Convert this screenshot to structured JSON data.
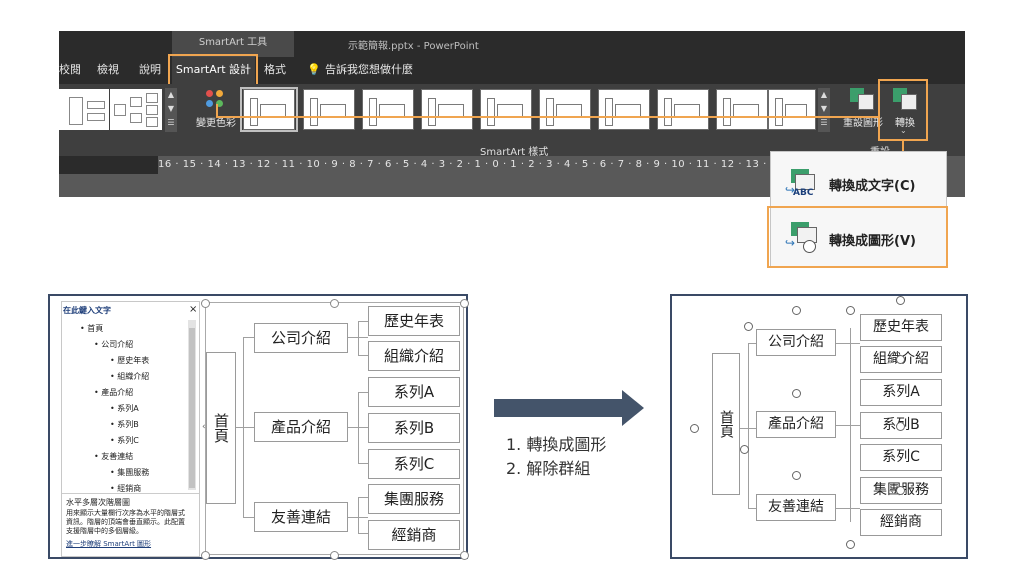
{
  "titlebar": {
    "context_group": "SmartArt 工具",
    "document": "示範簡報.pptx  -  PowerPoint"
  },
  "tabs": [
    "校閱",
    "檢視",
    "說明",
    "SmartArt 設計",
    "格式"
  ],
  "tell_me": "告訴我您想做什麼",
  "ribbon": {
    "change_colors": "變更色彩",
    "gallery_label": "SmartArt 樣式",
    "reset_group_label": "重設",
    "reset_button": "重設圖形",
    "convert_button": "轉換",
    "ruler": "16 · 15 · 14 · 13 · 12 · 11 · 10 · 9 · 8 · 7 · 6 · 5 · 4 · 3 · 2 · 1 · 0 · 1 · 2 · 3 · 4 · 5 · 6 · 7 · 8 · 9 · 10 · 11 · 12 · 13 · 14"
  },
  "convert_menu": {
    "to_text": "轉換成文字(C)",
    "to_shapes": "轉換成圖形(V)"
  },
  "text_pane": {
    "title": "在此鍵入文字",
    "close": "×",
    "items": [
      {
        "level": 1,
        "text": "首頁"
      },
      {
        "level": 2,
        "text": "公司介紹"
      },
      {
        "level": 3,
        "text": "歷史年表"
      },
      {
        "level": 3,
        "text": "組織介紹"
      },
      {
        "level": 2,
        "text": "產品介紹"
      },
      {
        "level": 3,
        "text": "系列A"
      },
      {
        "level": 3,
        "text": "系列B"
      },
      {
        "level": 3,
        "text": "系列C"
      },
      {
        "level": 2,
        "text": "友善連結"
      },
      {
        "level": 3,
        "text": "集團服務"
      },
      {
        "level": 3,
        "text": "經銷商"
      }
    ],
    "desc_title": "水平多層次階層圖",
    "desc_body_1": "用來顯示大量欄行次序為水平的階層式",
    "desc_body_2": "資訊。階層的頂端會垂直顯示。此配置",
    "desc_body_3": "支援階層中的多個層級。",
    "learn_more": "進一步瞭解 SmartArt 圖形"
  },
  "smartart": {
    "root": "首頁",
    "level2": [
      "公司介紹",
      "產品介紹",
      "友善連結"
    ],
    "level3": [
      "歷史年表",
      "組織介紹",
      "系列A",
      "系列B",
      "系列C",
      "集團服務",
      "經銷商"
    ]
  },
  "steps": [
    "1.  轉換成圖形",
    "2.  解除群組"
  ],
  "colors": {
    "accent_orange": "#f0a550",
    "arrow": "#44546a",
    "frame": "#3a4a66"
  }
}
